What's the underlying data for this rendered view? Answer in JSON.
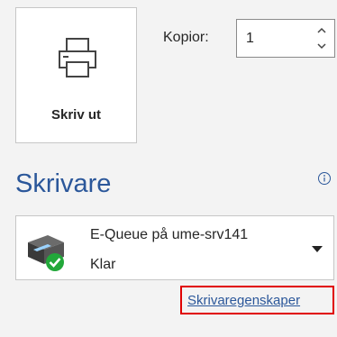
{
  "print": {
    "button_label": "Skriv ut"
  },
  "copies": {
    "label": "Kopior:",
    "value": "1"
  },
  "printer_section": {
    "title": "Skrivare",
    "selected_printer": {
      "name": "E-Queue på ume-srv141",
      "status": "Klar"
    },
    "properties_link": "Skrivaregenskaper"
  },
  "colors": {
    "accent": "#2b579a",
    "highlight_border": "#e00000",
    "status_ok": "#22a83a"
  },
  "icons": [
    "printer-icon",
    "chevron-up-icon",
    "chevron-down-icon",
    "info-icon",
    "printer-device-icon",
    "check-badge-icon",
    "dropdown-arrow-icon"
  ]
}
